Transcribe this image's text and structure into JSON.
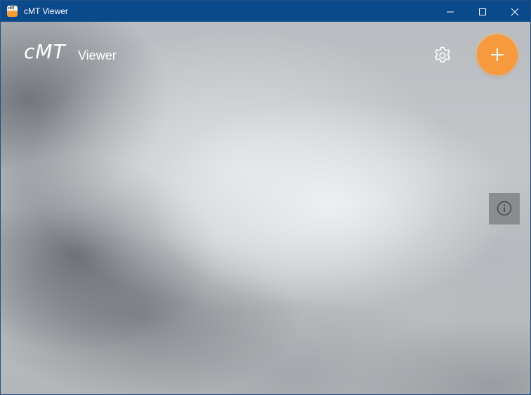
{
  "window": {
    "title": "cMT Viewer",
    "app_icon_text": "cMT"
  },
  "titlebar_controls": {
    "minimize": "minimize-icon",
    "maximize": "maximize-icon",
    "close": "close-icon"
  },
  "logo": {
    "main": "cMT",
    "sub": "Viewer"
  },
  "toolbar": {
    "settings_icon": "gear-icon",
    "add_icon": "plus-icon",
    "info_icon": "info-icon"
  },
  "colors": {
    "titlebar": "#0a4a8a",
    "accent": "#f79a3e",
    "info_panel": "#8a8d90"
  }
}
